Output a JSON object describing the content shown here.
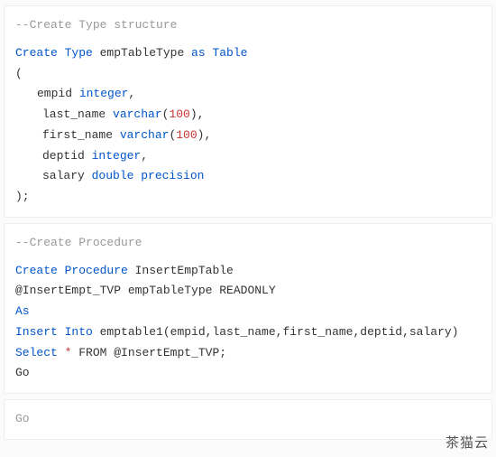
{
  "block1": {
    "comment": "--Create Type structure",
    "l1_kw": "Create Type",
    "l1_id": " empTableType ",
    "l1_kw2": "as Table",
    "l2": "(",
    "f1_name": "empid ",
    "f1_type": "integer",
    "f1_c": ",",
    "f2_name": "last_name ",
    "f2_type": "varchar",
    "f2_open": "(",
    "f2_num": "100",
    "f2_close": ")",
    "f2_c": ",",
    "f3_name": "first_name ",
    "f3_type": "varchar",
    "f3_open": "(",
    "f3_num": "100",
    "f3_close": ")",
    "f3_c": ",",
    "f4_name": "deptid ",
    "f4_type": "integer",
    "f4_c": ",",
    "f5_name": "salary ",
    "f5_type": "double precision",
    "l_end": ");"
  },
  "block2": {
    "comment": "--Create Procedure",
    "l1_kw": "Create Procedure",
    "l1_id": " InsertEmpTable",
    "l2_param": "@InsertEmpt_TVP",
    "l2_rest": " empTableType READONLY",
    "l3": "As",
    "l4_kw": "Insert Into",
    "l4_rest": " emptable1(empid,last_name,first_name,deptid,salary)",
    "l5_kw": "Select",
    "l5_star": " * ",
    "l5_from": "FROM",
    "l5_param": " @InsertEmpt_TVP",
    "l5_semi": ";",
    "l6": "Go"
  },
  "block3": {
    "go": "Go"
  },
  "watermark": "茶猫云"
}
